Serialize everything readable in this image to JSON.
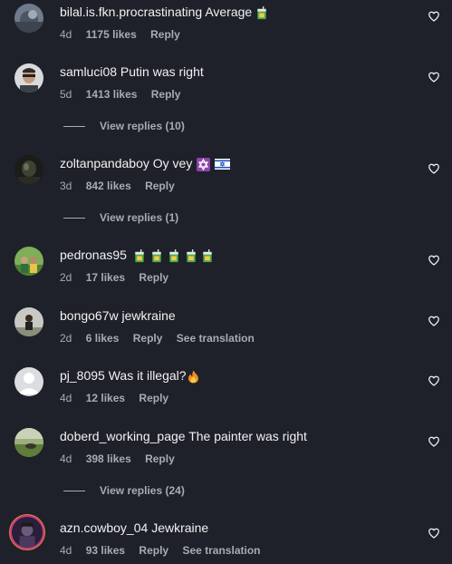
{
  "comments": [
    {
      "username": "bilal.is.fkn.procrastinating",
      "text": "Average",
      "emoji": "juice",
      "time": "4d",
      "likes": "1175 likes",
      "reply": "Reply"
    },
    {
      "username": "samluci08",
      "text": "Putin was right",
      "time": "5d",
      "likes": "1413 likes",
      "reply": "Reply",
      "view_replies": "View replies (10)"
    },
    {
      "username": "zoltanpandaboy",
      "text": "Oy vey",
      "emoji": "star-of-david-israel-flag",
      "time": "3d",
      "likes": "842 likes",
      "reply": "Reply",
      "view_replies": "View replies (1)"
    },
    {
      "username": "pedronas95",
      "text": "",
      "emoji": "juice-x5",
      "time": "2d",
      "likes": "17 likes",
      "reply": "Reply"
    },
    {
      "username": "bongo67w",
      "text": "jewkraine",
      "time": "2d",
      "likes": "6 likes",
      "reply": "Reply",
      "translation": "See translation"
    },
    {
      "username": "pj_8095",
      "text": "Was it illegal?",
      "emoji": "fire",
      "time": "4d",
      "likes": "12 likes",
      "reply": "Reply"
    },
    {
      "username": "doberd_working_page",
      "text": "The painter was right",
      "time": "4d",
      "likes": "398 likes",
      "reply": "Reply",
      "view_replies": "View replies (24)"
    },
    {
      "username": "azn.cowboy_04",
      "text": "Jewkraine",
      "time": "4d",
      "likes": "93 likes",
      "reply": "Reply",
      "translation": "See translation"
    }
  ],
  "colors": {
    "background": "#1e2129",
    "text": "#f1f2f4",
    "muted": "#a8abb3"
  }
}
